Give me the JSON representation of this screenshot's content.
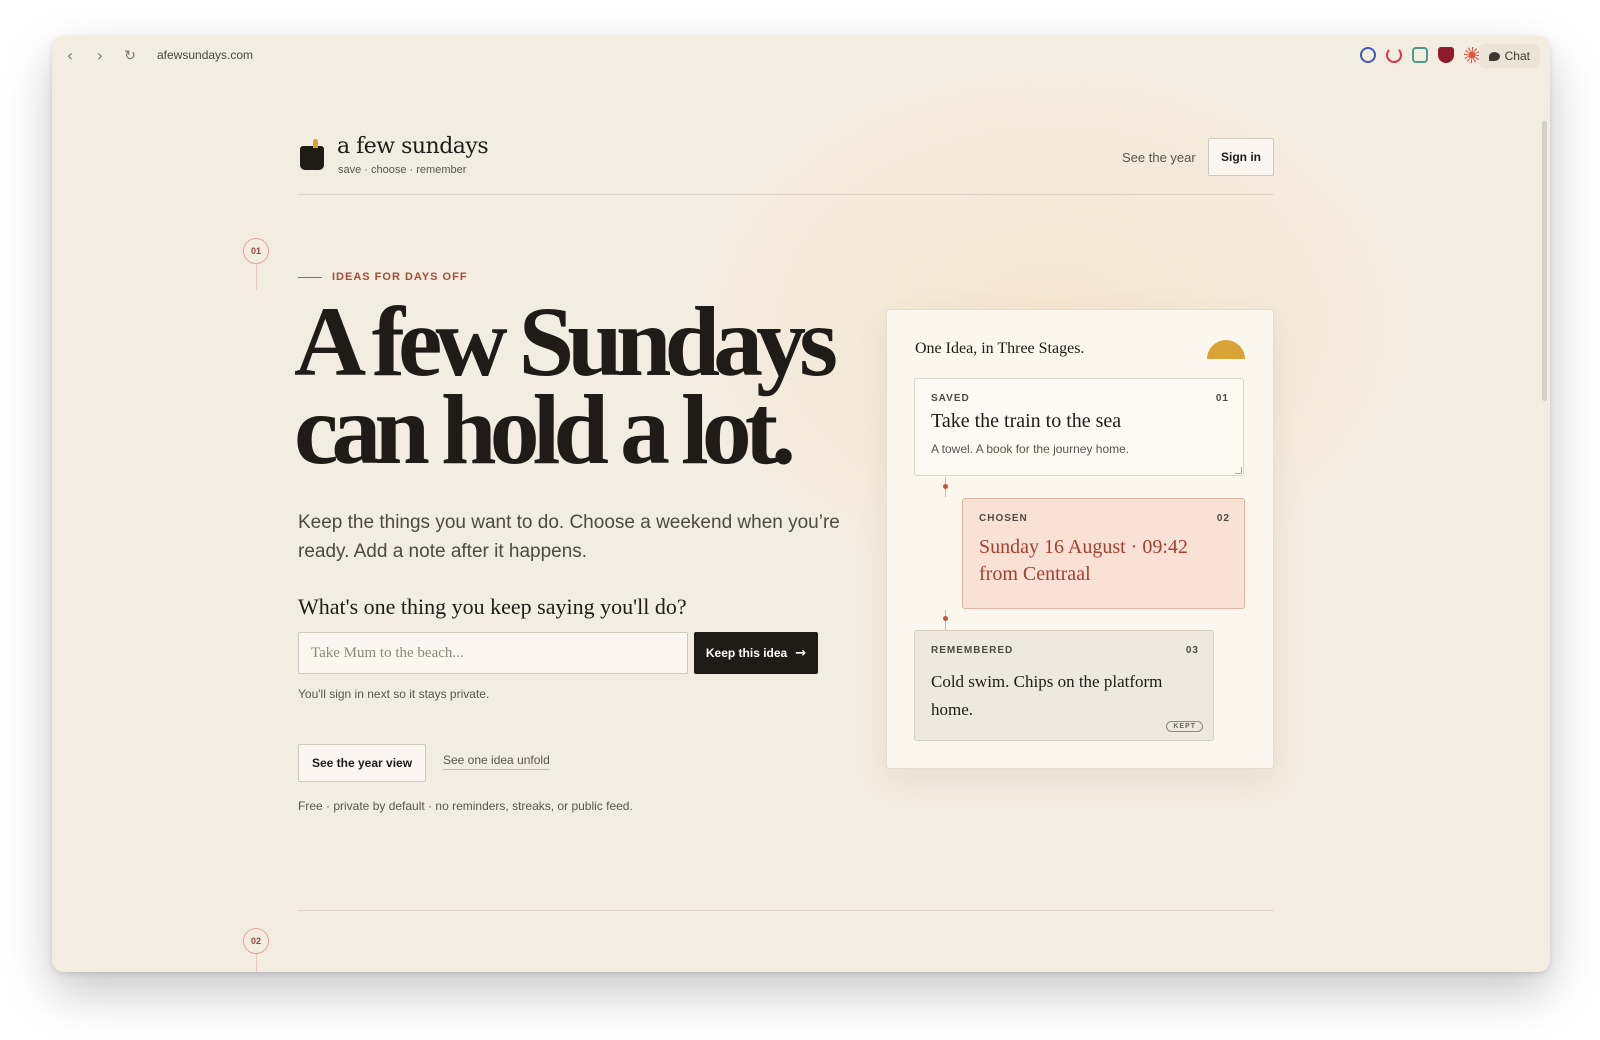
{
  "browser": {
    "url": "afewsundays.com",
    "back_icon": "‹",
    "forward_icon": "›",
    "reload_icon": "↻",
    "chat_label": "Chat",
    "extension_colors": [
      "#3b5bb5",
      "#d9344a",
      "#4a9b8a",
      "#8e1c2a",
      "#e2563a"
    ]
  },
  "header": {
    "brand_name": "a few sundays",
    "brand_tagline": "save · choose · remember",
    "nav_link": "See the year",
    "signin_label": "Sign in"
  },
  "steps": {
    "first": "01",
    "second": "02"
  },
  "hero": {
    "eyebrow": "IDEAS FOR DAYS OFF",
    "headline_line1": "A few Sundays",
    "headline_line2": "can hold a lot.",
    "lede": "Keep the things you want to do. Choose a weekend when you’re ready. Add a note after it happens.",
    "question": "What's one thing you keep saying you'll do?",
    "input_placeholder": "Take Mum to the beach...",
    "input_value": "",
    "keep_label": "Keep this idea",
    "keep_arrow": "→",
    "hint": "You'll sign in next so it stays private.",
    "year_view_label": "See the year view",
    "unfold_label": "See one idea unfold",
    "footnote": "Free · private by default · no reminders, streaks, or public feed."
  },
  "stages": {
    "title": "One Idea, in Three Stages.",
    "saved": {
      "label": "SAVED",
      "number": "01",
      "title": "Take the train to the sea",
      "note": "A towel. A book for the journey home."
    },
    "chosen": {
      "label": "CHOSEN",
      "number": "02",
      "title": "Sunday 16 August · 09:42 from Centraal"
    },
    "remembered": {
      "label": "REMEMBERED",
      "number": "03",
      "title": "Cold swim. Chips on the platform home.",
      "badge": "KEPT"
    }
  },
  "colors": {
    "page_bg": "#f3ece0",
    "ink": "#1f1b16",
    "accent_red": "#a64d3a",
    "sun_gold": "#d9a336",
    "chosen_bg": "#f9e1d6"
  }
}
